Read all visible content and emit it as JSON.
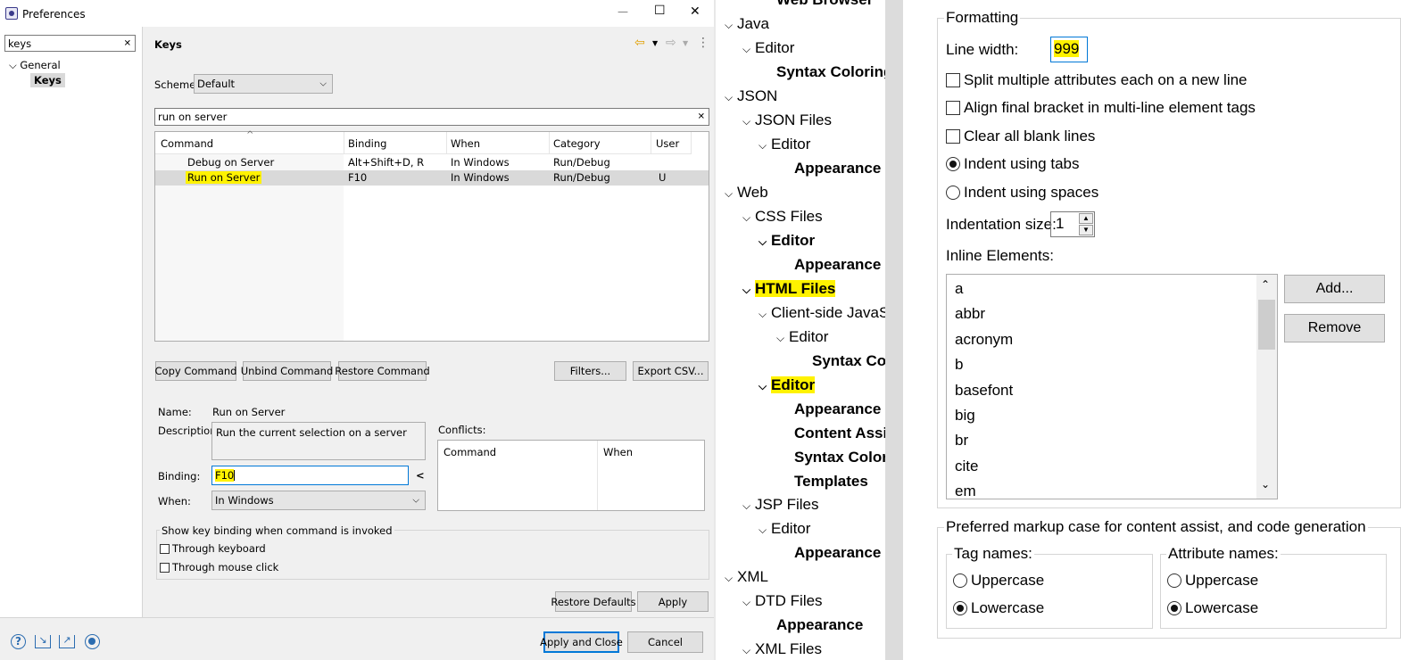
{
  "window": {
    "title": "Preferences",
    "minimize": "—",
    "maximize": "☐",
    "close": "✕"
  },
  "left_filter": {
    "value": "keys",
    "clear": "✕"
  },
  "left_tree": [
    {
      "label": "General",
      "chevron": "⌵"
    },
    {
      "label": "Keys"
    }
  ],
  "page": {
    "title": "Keys",
    "back_icon": "⇦",
    "fwd_icon": "⇨",
    "menu_icon": "⋮"
  },
  "scheme": {
    "label": "Scheme:",
    "value": "Default"
  },
  "command_filter": {
    "value": "run on server",
    "clear": "✕"
  },
  "table": {
    "headers": [
      "Command",
      "Binding",
      "When",
      "Category",
      "User"
    ],
    "rows": [
      [
        "Debug on Server",
        "Alt+Shift+D, R",
        "In Windows",
        "Run/Debug",
        ""
      ],
      [
        "Run on Server",
        "F10",
        "In Windows",
        "Run/Debug",
        "U"
      ]
    ]
  },
  "buttons": {
    "copy": "Copy Command",
    "unbind": "Unbind Command",
    "restore_cmd": "Restore Command",
    "filters": "Filters...",
    "export": "Export CSV...",
    "restore_defaults": "Restore Defaults",
    "apply": "Apply",
    "apply_close": "Apply and Close",
    "cancel": "Cancel"
  },
  "details": {
    "name_label": "Name:",
    "name_value": "Run on Server",
    "desc_label": "Description:",
    "desc_value": "Run the current selection on a server",
    "binding_label": "Binding:",
    "binding_value": "F10",
    "when_label": "When:",
    "when_value": "In Windows",
    "conflicts_label": "Conflicts:",
    "conflicts_headers": [
      "Command",
      "When"
    ]
  },
  "show_binding": {
    "title": "Show key binding when command is invoked",
    "keyboard": "Through keyboard",
    "mouse": "Through mouse click"
  },
  "middle_tree": [
    {
      "label": "Web Browser",
      "bold": true
    },
    {
      "label": "Java",
      "chev": true
    },
    {
      "label": "Editor",
      "chev": true
    },
    {
      "label": "Syntax Coloring",
      "bold": true
    },
    {
      "label": "JSON",
      "chev": true
    },
    {
      "label": "JSON Files",
      "chev": true
    },
    {
      "label": "Editor",
      "chev": true
    },
    {
      "label": "Appearance",
      "bold": true
    },
    {
      "label": "Web",
      "chev": true
    },
    {
      "label": "CSS Files",
      "chev": true
    },
    {
      "label": "Editor",
      "chev": true,
      "bold": true
    },
    {
      "label": "Appearance",
      "bold": true
    },
    {
      "label": "HTML Files",
      "chev": true,
      "bold": true,
      "hl": true
    },
    {
      "label": "Client-side JavaSc",
      "chev": true
    },
    {
      "label": "Editor",
      "chev": true
    },
    {
      "label": "Syntax Colc",
      "bold": true
    },
    {
      "label": "Editor",
      "chev": true,
      "bold": true,
      "hl": true
    },
    {
      "label": "Appearance",
      "bold": true
    },
    {
      "label": "Content Assis",
      "bold": true
    },
    {
      "label": "Syntax Colorir",
      "bold": true
    },
    {
      "label": "Templates",
      "bold": true
    },
    {
      "label": "JSP Files",
      "chev": true
    },
    {
      "label": "Editor",
      "chev": true
    },
    {
      "label": "Appearance",
      "bold": true
    },
    {
      "label": "XML",
      "chev": true
    },
    {
      "label": "DTD Files",
      "chev": true
    },
    {
      "label": "Appearance",
      "bold": true
    },
    {
      "label": "XML Files",
      "chev": true
    }
  ],
  "formatting": {
    "title": "Formatting",
    "line_width_label": "Line width:",
    "line_width_value": "999",
    "split_attrs": "Split multiple attributes each on a new line",
    "align_bracket": "Align final bracket in multi-line element tags",
    "clear_blank": "Clear all blank lines",
    "indent_tabs": "Indent using tabs",
    "indent_spaces": "Indent using spaces",
    "indent_size_label": "Indentation size:",
    "indent_size_value": "1",
    "inline_label": "Inline Elements:",
    "inline_elements": [
      "a",
      "abbr",
      "acronym",
      "b",
      "basefont",
      "big",
      "br",
      "cite",
      "em"
    ],
    "add_button": "Add...",
    "remove_button": "Remove"
  },
  "markup_case": {
    "title": "Preferred markup case for content assist, and code generation",
    "tag_names": "Tag names:",
    "attr_names": "Attribute names:",
    "uppercase": "Uppercase",
    "lowercase": "Lowercase"
  },
  "colors": {
    "highlight": "#fff200",
    "selected_row": "#d9d9d9",
    "focus_border": "#0078d7"
  }
}
